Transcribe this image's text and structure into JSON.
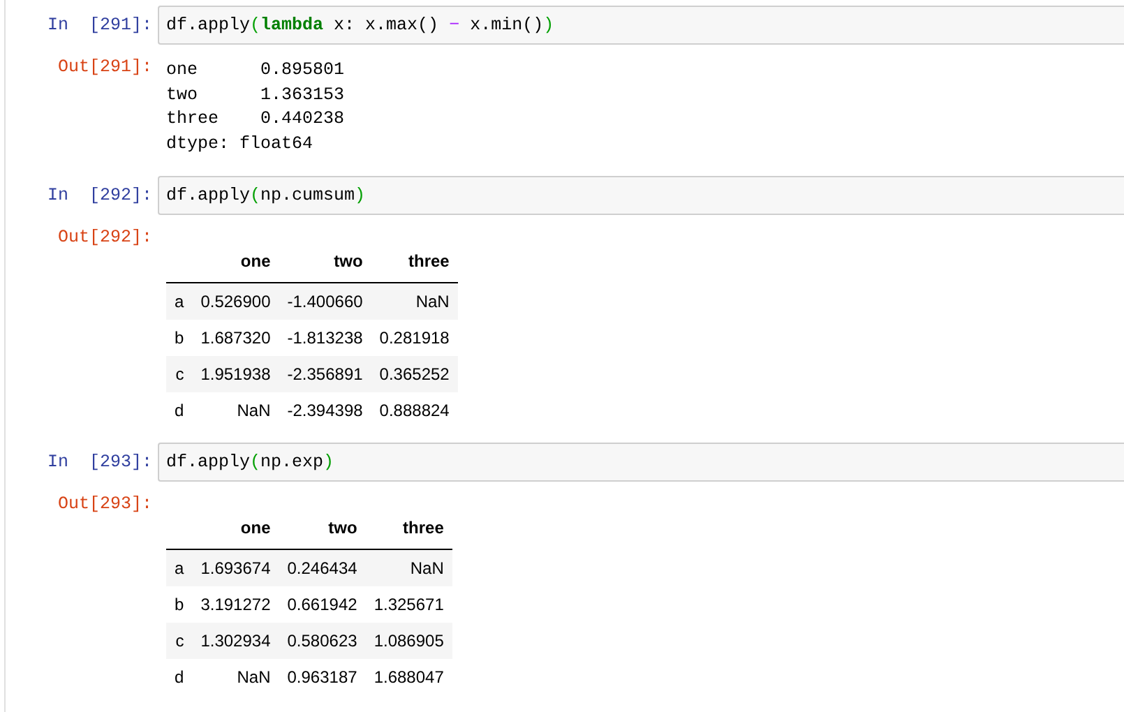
{
  "cells": [
    {
      "prompt_in": "In  [291]:",
      "code": [
        {
          "kind": "plain",
          "text": "df.apply"
        },
        {
          "kind": "paren",
          "text": "("
        },
        {
          "kind": "keyword",
          "text": "lambda"
        },
        {
          "kind": "plain",
          "text": " x: x.max() "
        },
        {
          "kind": "operator",
          "text": "−"
        },
        {
          "kind": "plain",
          "text": " x.min()"
        },
        {
          "kind": "paren",
          "text": ")"
        }
      ],
      "prompt_out": "Out[291]:",
      "output": {
        "kind": "text",
        "lines": [
          "one      0.895801",
          "two      1.363153",
          "three    0.440238",
          "dtype: float64"
        ]
      }
    },
    {
      "prompt_in": "In  [292]:",
      "code": [
        {
          "kind": "plain",
          "text": "df.apply"
        },
        {
          "kind": "paren",
          "text": "("
        },
        {
          "kind": "plain",
          "text": "np.cumsum"
        },
        {
          "kind": "paren",
          "text": ")"
        }
      ],
      "prompt_out": "Out[292]:",
      "output": {
        "kind": "table",
        "columns": [
          "",
          "one",
          "two",
          "three"
        ],
        "rows": [
          [
            "a",
            "0.526900",
            "-1.400660",
            "NaN"
          ],
          [
            "b",
            "1.687320",
            "-1.813238",
            "0.281918"
          ],
          [
            "c",
            "1.951938",
            "-2.356891",
            "0.365252"
          ],
          [
            "d",
            "NaN",
            "-2.394398",
            "0.888824"
          ]
        ]
      }
    },
    {
      "prompt_in": "In  [293]:",
      "code": [
        {
          "kind": "plain",
          "text": "df.apply"
        },
        {
          "kind": "paren",
          "text": "("
        },
        {
          "kind": "plain",
          "text": "np.exp"
        },
        {
          "kind": "paren",
          "text": ")"
        }
      ],
      "prompt_out": "Out[293]:",
      "output": {
        "kind": "table",
        "columns": [
          "",
          "one",
          "two",
          "three"
        ],
        "rows": [
          [
            "a",
            "1.693674",
            "0.246434",
            "NaN"
          ],
          [
            "b",
            "3.191272",
            "0.661942",
            "1.325671"
          ],
          [
            "c",
            "1.302934",
            "0.580623",
            "1.086905"
          ],
          [
            "d",
            "NaN",
            "0.963187",
            "1.688047"
          ]
        ]
      }
    }
  ]
}
